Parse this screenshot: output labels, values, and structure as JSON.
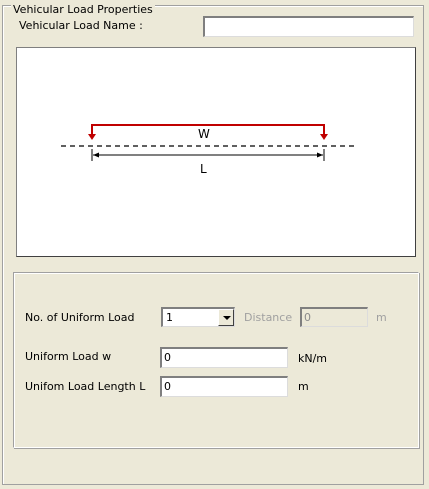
{
  "group": {
    "title": "Vehicular Load Properties"
  },
  "name_row": {
    "label": "Vehicular Load Name :",
    "value": ""
  },
  "diagram": {
    "load_label": "W",
    "length_label": "L"
  },
  "form": {
    "num_uniform": {
      "label": "No. of Uniform Load",
      "selected": "1"
    },
    "distance": {
      "label": "Distance",
      "value": "0",
      "unit": "m"
    },
    "uniform_w": {
      "label": "Uniform Load w",
      "value": "0",
      "unit": "kN/m"
    },
    "uniform_len": {
      "label": "Unifom Load Length L",
      "value": "0",
      "unit": "m"
    }
  },
  "colors": {
    "load_line": "#C00000",
    "background": "#ECE9D8"
  }
}
